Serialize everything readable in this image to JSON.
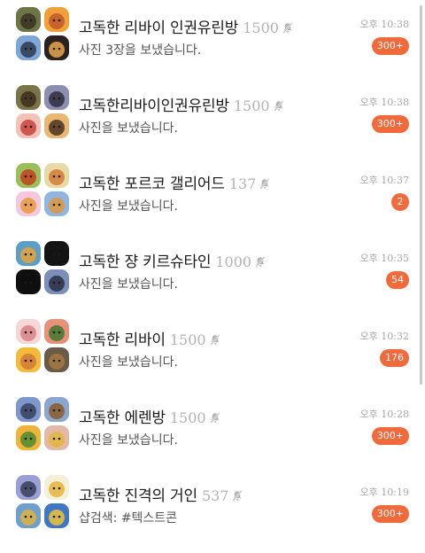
{
  "colors": {
    "badge": "#f06a3c",
    "scrollbar": "#c9c9c9"
  },
  "chats": [
    {
      "title": "고독한 리바이 인권유린방",
      "member_count": "1500",
      "muted": true,
      "preview": "사진 3장을 보냈습니다.",
      "time": "오후 10:38",
      "unread": "300+",
      "avatars": [
        {
          "icon": "character-avatar-icon",
          "bg": "#6d7446",
          "fg": "#3b3222"
        },
        {
          "icon": "character-avatar-icon",
          "bg": "#f2a13a",
          "fg": "#c2572a"
        },
        {
          "icon": "character-avatar-icon",
          "bg": "#7ea7d8",
          "fg": "#2b3b4d"
        },
        {
          "icon": "character-avatar-icon",
          "bg": "#2a2220",
          "fg": "#e8a64a"
        }
      ]
    },
    {
      "title": "고독한리바이인권유린방",
      "member_count": "1500",
      "muted": true,
      "preview": "사진을 보냈습니다.",
      "time": "오후 10:38",
      "unread": "300+",
      "avatars": [
        {
          "icon": "character-avatar-icon",
          "bg": "#7a7448",
          "fg": "#3c2f1f"
        },
        {
          "icon": "character-avatar-icon",
          "bg": "#8c8fb0",
          "fg": "#2f2e40"
        },
        {
          "icon": "character-avatar-icon",
          "bg": "#f4c2b8",
          "fg": "#c8443a"
        },
        {
          "icon": "character-avatar-icon",
          "bg": "#e8b873",
          "fg": "#4a3320"
        }
      ]
    },
    {
      "title": "고독한 포르코 갤리어드",
      "member_count": "137",
      "muted": true,
      "preview": "사진을 보냈습니다.",
      "time": "오후 10:37",
      "unread": "2",
      "avatars": [
        {
          "icon": "character-avatar-icon",
          "bg": "#9bbf5a",
          "fg": "#c2411f"
        },
        {
          "icon": "character-avatar-icon",
          "bg": "#e8d9a6",
          "fg": "#d57a35"
        },
        {
          "icon": "character-avatar-icon",
          "bg": "#f3c7df",
          "fg": "#e89a3a"
        },
        {
          "icon": "character-avatar-icon",
          "bg": "#8fb6e0",
          "fg": "#e0973a"
        }
      ]
    },
    {
      "title": "고독한 쟝 키르슈타인",
      "member_count": "1000",
      "muted": true,
      "preview": "사진을 보냈습니다.",
      "time": "오후 10:35",
      "unread": "54",
      "avatars": [
        {
          "icon": "character-avatar-icon",
          "bg": "#5b9fc4",
          "fg": "#e8a23a"
        },
        {
          "icon": "character-avatar-icon",
          "bg": "#141414",
          "fg": "#141414"
        },
        {
          "icon": "character-avatar-icon",
          "bg": "#0f0f0f",
          "fg": "#0f0f0f"
        },
        {
          "icon": "character-avatar-icon",
          "bg": "#7b8fb8",
          "fg": "#2b2f44"
        }
      ]
    },
    {
      "title": "고독한 리바이",
      "member_count": "1500",
      "muted": true,
      "preview": "사진을 보냈습니다.",
      "time": "오후 10:32",
      "unread": "176",
      "avatars": [
        {
          "icon": "character-avatar-icon",
          "bg": "#f7d6d6",
          "fg": "#d7848a"
        },
        {
          "icon": "character-avatar-icon",
          "bg": "#e8907a",
          "fg": "#3f7a2e"
        },
        {
          "icon": "character-avatar-icon",
          "bg": "#f1bc3a",
          "fg": "#d1793a"
        },
        {
          "icon": "character-avatar-icon",
          "bg": "#6a5a48",
          "fg": "#a77a3f"
        }
      ]
    },
    {
      "title": "고독한 에렌방",
      "member_count": "1500",
      "muted": true,
      "preview": "사진을 보냈습니다.",
      "time": "오후 10:28",
      "unread": "300+",
      "avatars": [
        {
          "icon": "character-avatar-icon",
          "bg": "#7f97d0",
          "fg": "#3a3f5e"
        },
        {
          "icon": "character-avatar-icon",
          "bg": "#8ca7cf",
          "fg": "#8a5a2a"
        },
        {
          "icon": "character-avatar-icon",
          "bg": "#f0b43a",
          "fg": "#4d8a34"
        },
        {
          "icon": "character-avatar-icon",
          "bg": "#e3b8a8",
          "fg": "#e1b83a"
        }
      ]
    },
    {
      "title": "고독한 진격의 거인",
      "member_count": "537",
      "muted": true,
      "preview": "샵검색: #텍스트콘",
      "time": "오후 10:19",
      "unread": "300+",
      "avatars": [
        {
          "icon": "character-avatar-icon",
          "bg": "#9a9fd4",
          "fg": "#3a3f5e"
        },
        {
          "icon": "character-avatar-icon",
          "bg": "#f4efd9",
          "fg": "#e6b33a"
        },
        {
          "icon": "character-avatar-icon",
          "bg": "#6d9fcf",
          "fg": "#e0b23a"
        },
        {
          "icon": "character-avatar-icon",
          "bg": "#3f77c4",
          "fg": "#efc23a"
        }
      ]
    }
  ]
}
